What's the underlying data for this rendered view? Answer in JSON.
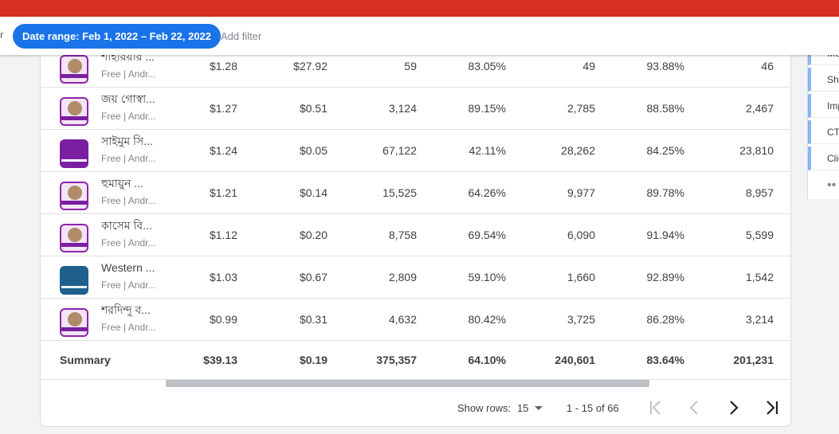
{
  "filter_bar": {
    "cut_text": "r",
    "date_range_chip": "Date range: Feb 1, 2022 – Feb 22, 2022",
    "add_filter": "Add filter"
  },
  "rows": [
    {
      "name": "শাহারয়ার ...",
      "sub": "Free | Andr...",
      "icon": "author-portrait-icon",
      "v1": "$1.28",
      "v2": "$27.92",
      "v3": "59",
      "v4": "83.05%",
      "v5": "49",
      "v6": "93.88%",
      "v7": "46"
    },
    {
      "name": "জয় গোস্বা...",
      "sub": "Free | Andr...",
      "icon": "author-portrait-icon",
      "v1": "$1.27",
      "v2": "$0.51",
      "v3": "3,124",
      "v4": "89.15%",
      "v5": "2,785",
      "v6": "88.58%",
      "v7": "2,467"
    },
    {
      "name": "সাইমুম সি...",
      "sub": "Free | Andr...",
      "icon": "book-title-icon",
      "v1": "$1.24",
      "v2": "$0.05",
      "v3": "67,122",
      "v4": "42.11%",
      "v5": "28,262",
      "v6": "84.25%",
      "v7": "23,810"
    },
    {
      "name": "হুমায়ুন ...",
      "sub": "Free | Andr...",
      "icon": "author-portrait-icon",
      "v1": "$1.21",
      "v2": "$0.14",
      "v3": "15,525",
      "v4": "64.26%",
      "v5": "9,977",
      "v6": "89.78%",
      "v7": "8,957"
    },
    {
      "name": "কাসেম বি...",
      "sub": "Free | Andr...",
      "icon": "author-portrait-icon",
      "v1": "$1.12",
      "v2": "$0.20",
      "v3": "8,758",
      "v4": "69.54%",
      "v5": "6,090",
      "v6": "91.94%",
      "v7": "5,599"
    },
    {
      "name": "Western ...",
      "sub": "Free | Andr...",
      "icon": "western-book-icon",
      "v1": "$1.03",
      "v2": "$0.67",
      "v3": "2,809",
      "v4": "59.10%",
      "v5": "1,660",
      "v6": "92.89%",
      "v7": "1,542"
    },
    {
      "name": "শরদিন্দু ব...",
      "sub": "Free | Andr...",
      "icon": "author-portrait-icon",
      "v1": "$0.99",
      "v2": "$0.31",
      "v3": "4,632",
      "v4": "80.42%",
      "v5": "3,725",
      "v6": "86.28%",
      "v7": "3,214"
    }
  ],
  "summary": {
    "label": "Summary",
    "v1": "$39.13",
    "v2": "$0.19",
    "v3": "375,357",
    "v4": "64.10%",
    "v5": "240,601",
    "v6": "83.64%",
    "v7": "201,231"
  },
  "pager": {
    "show_rows_label": "Show rows:",
    "rows_value": "15",
    "range": "1 - 15 of 66"
  },
  "right_panel": {
    "items": [
      "Me",
      "Sho",
      "Imp",
      "CT",
      "Clic"
    ],
    "more": "••"
  },
  "colors": {
    "top_bar": "#d93025",
    "chip": "#1a73e8",
    "panel_accent": "#8ab4f8"
  }
}
